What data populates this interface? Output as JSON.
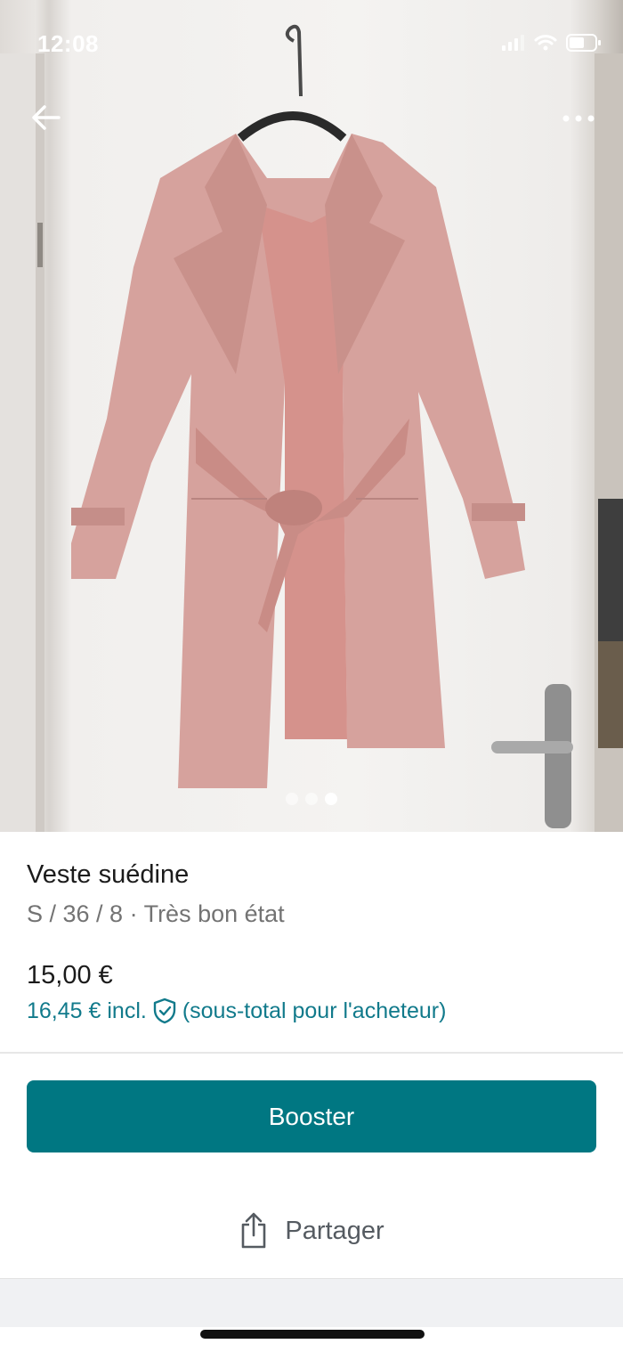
{
  "status": {
    "time": "12:08"
  },
  "item": {
    "title": "Veste suédine",
    "details": "S / 36 / 8 · Très bon état",
    "price": "15,00 €",
    "buyer_price_amount": "16,45 € incl.",
    "buyer_price_note": "(sous-total pour l'acheteur)"
  },
  "gallery": {
    "photo_count": 3,
    "active_index": 3
  },
  "actions": {
    "booster_label": "Booster",
    "share_label": "Partager"
  },
  "icons": {
    "back": "back-arrow-icon",
    "more": "more-dots-icon",
    "shield": "shield-check-icon",
    "share": "share-icon"
  },
  "colors": {
    "accent": "#007782",
    "buyer_price": "#117a8b",
    "coat": "#d39c98"
  }
}
